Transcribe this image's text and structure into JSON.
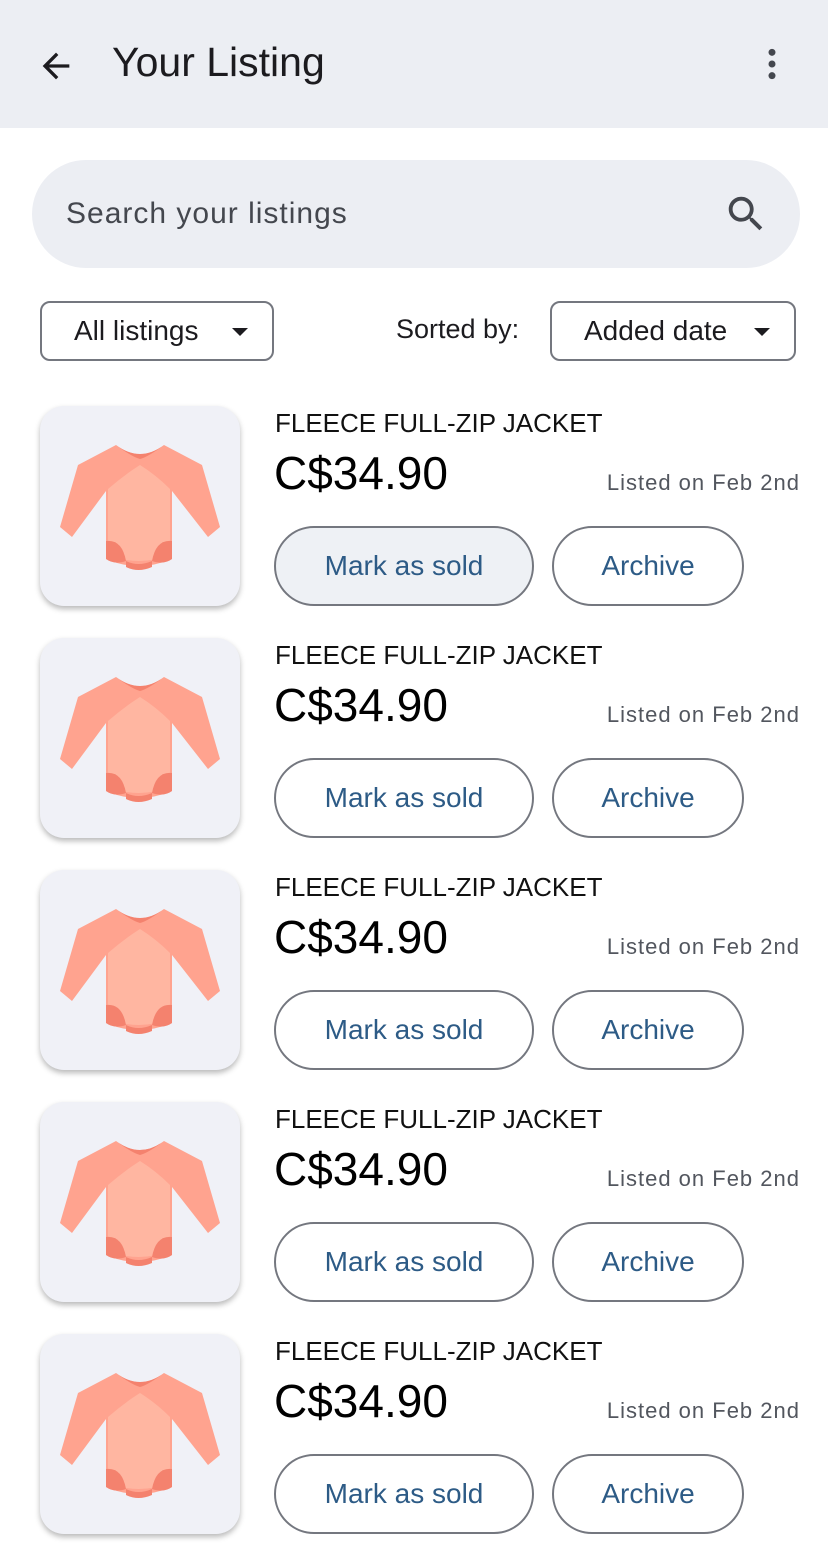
{
  "appbar": {
    "title": "Your Listing",
    "back_icon": "arrow-back-icon",
    "more_icon": "more-vert-icon"
  },
  "search": {
    "placeholder": "Search your listings",
    "icon": "search-icon"
  },
  "filters": {
    "filter_value": "All listings",
    "sort_label": "Sorted by:",
    "sort_value": "Added date"
  },
  "colors": {
    "appbar_bg": "#eceef3",
    "button_text": "#2d5b86",
    "product_color": "#ffb6a1"
  },
  "listings": [
    {
      "title": "FLEECE FULL-ZIP JACKET",
      "price": "C$34.90",
      "date": "Listed on Feb 2nd",
      "mark_sold_label": "Mark as sold",
      "archive_label": "Archive",
      "pressed": true
    },
    {
      "title": "FLEECE FULL-ZIP JACKET",
      "price": "C$34.90",
      "date": "Listed on Feb 2nd",
      "mark_sold_label": "Mark as sold",
      "archive_label": "Archive",
      "pressed": false
    },
    {
      "title": "FLEECE FULL-ZIP JACKET",
      "price": "C$34.90",
      "date": "Listed on Feb 2nd",
      "mark_sold_label": "Mark as sold",
      "archive_label": "Archive",
      "pressed": false
    },
    {
      "title": "FLEECE FULL-ZIP JACKET",
      "price": "C$34.90",
      "date": "Listed on Feb 2nd",
      "mark_sold_label": "Mark as sold",
      "archive_label": "Archive",
      "pressed": false
    },
    {
      "title": "FLEECE FULL-ZIP JACKET",
      "price": "C$34.90",
      "date": "Listed on Feb 2nd",
      "mark_sold_label": "Mark as sold",
      "archive_label": "Archive",
      "pressed": false
    }
  ]
}
